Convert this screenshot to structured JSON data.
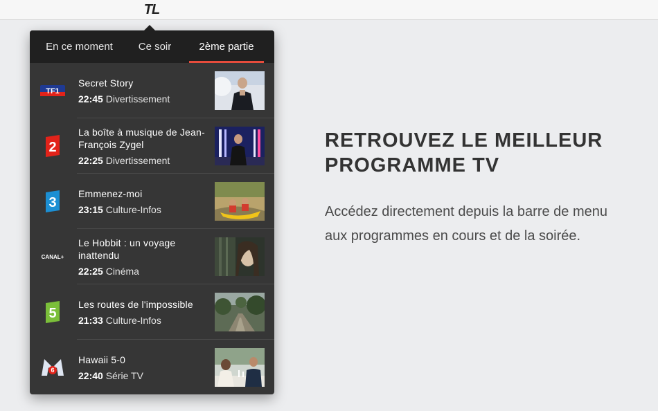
{
  "menubar": {
    "logo_text": "TL",
    "logo_icon": "tl-app-icon"
  },
  "popover": {
    "tabs": [
      {
        "label": "En ce moment",
        "active": false
      },
      {
        "label": "Ce soir",
        "active": false
      },
      {
        "label": "2ème partie",
        "active": true
      }
    ],
    "accent_color": "#e74c3c",
    "programs": [
      {
        "channel": "TF1",
        "channel_icon": "tf1-logo-icon",
        "title": "Secret Story",
        "time": "22:45",
        "genre": "Divertissement",
        "thumbnail": "presenter-on-stage"
      },
      {
        "channel": "2",
        "channel_icon": "france2-logo-icon",
        "title": "La boîte à musique de Jean-François Zygel",
        "time": "22:25",
        "genre": "Divertissement",
        "thumbnail": "host-in-studio"
      },
      {
        "channel": "3",
        "channel_icon": "france3-logo-icon",
        "title": "Emmenez-moi",
        "time": "23:15",
        "genre": "Culture-Infos",
        "thumbnail": "people-in-kayak"
      },
      {
        "channel": "CANAL+",
        "channel_icon": "canal-plus-logo-icon",
        "title": "Le Hobbit : un voyage inattendu",
        "time": "22:25",
        "genre": "Cinéma",
        "thumbnail": "film-still-forest"
      },
      {
        "channel": "5",
        "channel_icon": "france5-logo-icon",
        "title": "Les routes de l'impossible",
        "time": "21:33",
        "genre": "Culture-Infos",
        "thumbnail": "jungle-road"
      },
      {
        "channel": "M6",
        "channel_icon": "m6-logo-icon",
        "title": "Hawaii 5-0",
        "time": "22:40",
        "genre": "Série TV",
        "thumbnail": "couple-dinner"
      }
    ]
  },
  "hero": {
    "title": "RETROUVEZ LE MEILLEUR PROGRAMME TV",
    "text": "Accédez directement depuis la barre de menu aux programmes en cours et de la soirée."
  }
}
